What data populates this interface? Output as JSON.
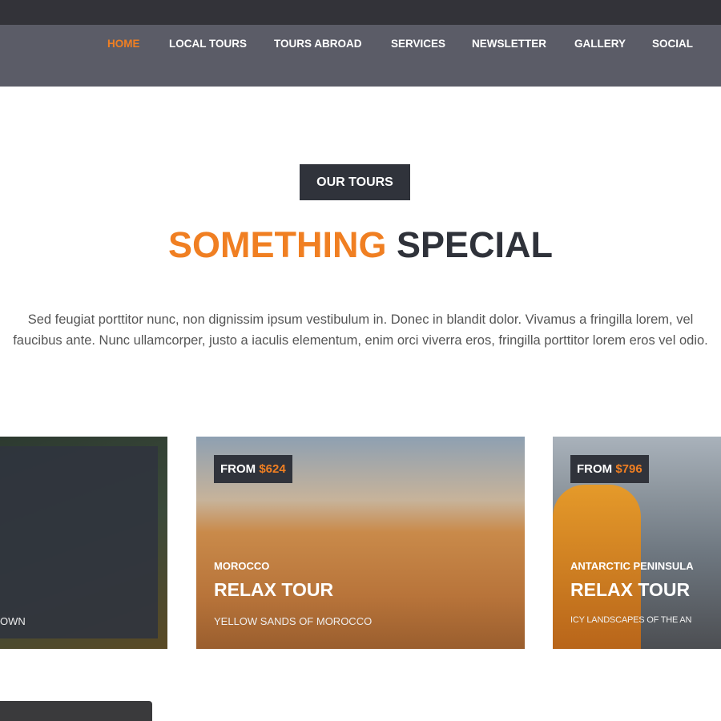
{
  "nav": {
    "items": [
      "HOME",
      "LOCAL TOURS",
      "TOURS ABROAD",
      "SERVICES",
      "NEWSLETTER",
      "GALLERY",
      "SOCIAL"
    ],
    "active": "HOME"
  },
  "section": {
    "badge": "OUR TOURS",
    "title_accent": "SOMETHING",
    "title_rest": "SPECIAL",
    "lead": "Sed feugiat porttitor nunc, non dignissim ipsum vestibulum in. Donec in blandit dolor. Vivamus a fringilla lorem, vel faucibus ante. Nunc ullamcorper, justo a iaculis elementum, enim orci viverra eros, fringilla porttitor lorem eros vel odio."
  },
  "cards": [
    {
      "subtitle": "OWN"
    },
    {
      "price_label": "FROM",
      "price": "$624",
      "location": "MOROCCO",
      "name": "RELAX TOUR",
      "subtitle": "YELLOW SANDS OF MOROCCO"
    },
    {
      "price_label": "FROM",
      "price": "$796",
      "location": "ANTARCTIC PENINSULA",
      "name": "RELAX TOUR",
      "subtitle": "ICY LANDSCAPES OF THE AN"
    }
  ],
  "colors": {
    "accent": "#f07f22",
    "dark": "#30333b",
    "nav": "#5b5c67"
  }
}
